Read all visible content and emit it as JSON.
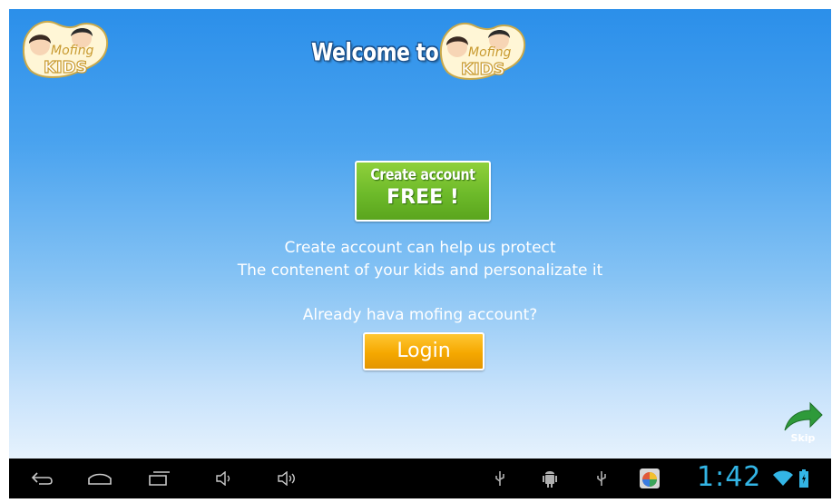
{
  "app": {
    "welcome_text": "Welcome to",
    "logo_text_top": "Mofing",
    "logo_text_bottom": "KIDS"
  },
  "create_account": {
    "line1": "Create account",
    "line2": "FREE !"
  },
  "info": {
    "line1": "Create account can help us protect",
    "line2": "The contenent of your kids and personalizate it"
  },
  "login": {
    "prompt": "Already hava mofing account?",
    "button_label": "Login"
  },
  "skip": {
    "label": "Skip"
  },
  "status_bar": {
    "time": "1:42",
    "icons": [
      "back-icon",
      "home-icon",
      "recent-apps-icon",
      "volume-down-icon",
      "volume-up-icon",
      "usb-icon",
      "android-debug-icon",
      "usb-icon",
      "app-notification-icon",
      "wifi-icon",
      "battery-charging-icon"
    ]
  },
  "colors": {
    "create_button": "#6dba2a",
    "login_button": "#f5a800",
    "clock": "#33b5e5",
    "background_top": "#2b8fea"
  }
}
